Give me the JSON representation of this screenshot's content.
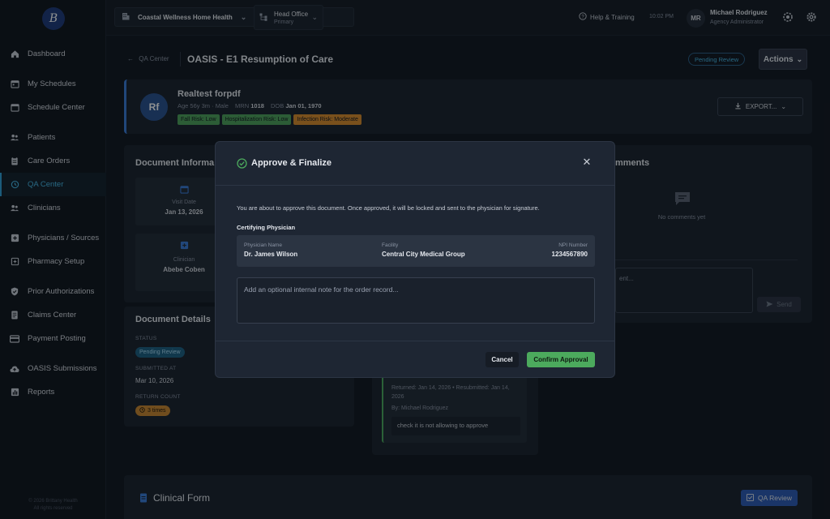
{
  "app": {
    "logo_text": "B",
    "footer_line1": "© 2026 Brittany Health",
    "footer_line2": "All rights reserved"
  },
  "topbar": {
    "org_name": "Coastal Wellness Home Health",
    "office_name": "Head Office",
    "office_sub": "Primary",
    "help_label": "Help & Training",
    "time": "10:02 PM",
    "user_initials": "MR",
    "user_name": "Michael Rodriguez",
    "user_role": "Agency Administrator"
  },
  "sidebar": {
    "items": [
      {
        "label": "Dashboard",
        "icon": "home-icon"
      },
      {
        "label": "My Schedules",
        "icon": "calendar-icon"
      },
      {
        "label": "Schedule Center",
        "icon": "calendar-icon"
      },
      {
        "label": "Patients",
        "icon": "users-icon"
      },
      {
        "label": "Care Orders",
        "icon": "clipboard-icon"
      },
      {
        "label": "QA Center",
        "icon": "history-icon",
        "active": true
      },
      {
        "label": "Clinicians",
        "icon": "users-icon"
      },
      {
        "label": "Physicians / Sources",
        "icon": "plus-square-icon"
      },
      {
        "label": "Pharmacy Setup",
        "icon": "pharmacy-icon"
      },
      {
        "label": "Prior Authorizations",
        "icon": "shield-check-icon"
      },
      {
        "label": "Claims Center",
        "icon": "document-icon"
      },
      {
        "label": "Payment Posting",
        "icon": "credit-card-icon"
      },
      {
        "label": "OASIS Submissions",
        "icon": "cloud-upload-icon"
      },
      {
        "label": "Reports",
        "icon": "chart-icon"
      }
    ]
  },
  "page": {
    "back_label": "QA Center",
    "title": "OASIS - E1 Resumption of Care",
    "status_pill": "Pending Review",
    "actions_label": "Actions"
  },
  "patient": {
    "initials": "Rf",
    "name": "Realtest forpdf",
    "age_sex": "Age 56y 3m · Male",
    "mrn_label": "MRN",
    "mrn": "1018",
    "dob_label": "DOB",
    "dob": "Jan 01, 1970",
    "risks": [
      {
        "label": "Fall Risk: Low",
        "color": "#4da05a"
      },
      {
        "label": "Hospitalization Risk: Low",
        "color": "#4da05a"
      },
      {
        "label": "Infection Risk: Moderate",
        "color": "#d98b2b"
      }
    ],
    "export_label": "EXPORT..."
  },
  "doc_info": {
    "title": "Document Informa",
    "visit_date_label": "Visit Date",
    "visit_date": "Jan 13, 2026",
    "clinician_label": "Clinician",
    "clinician": "Abebe Coben"
  },
  "doc_details": {
    "title": "Document Details",
    "status_label": "STATUS",
    "status": "Pending Review",
    "submitted_label": "SUBMITTED AT",
    "submitted": "Mar 10, 2026",
    "return_label": "RETURN COUNT",
    "return_count": "3 times"
  },
  "comments": {
    "title": "mments",
    "empty": "No comments yet",
    "input_placeholder": "ent...",
    "send_label": "Send"
  },
  "history": {
    "meta": "Returned: Jan 14, 2026 • Resubmitted: Jan 14, 2026",
    "by": "By: Michael Rodriguez",
    "note": "check it is not allowing to approve"
  },
  "clinical": {
    "title": "Clinical Form",
    "qa_review_label": "QA Review"
  },
  "modal": {
    "title": "Approve & Finalize",
    "message": "You are about to approve this document. Once approved, it will be locked and sent to the physician for signature.",
    "cert_label": "Certifying Physician",
    "physician_label": "Physician Name",
    "physician": "Dr. James Wilson",
    "facility_label": "Facility",
    "facility": "Central City Medical Group",
    "npi_label": "NPI Number",
    "npi": "1234567890",
    "note_placeholder": "Add an optional internal note for the order record...",
    "cancel_label": "Cancel",
    "confirm_label": "Confirm Approval"
  }
}
